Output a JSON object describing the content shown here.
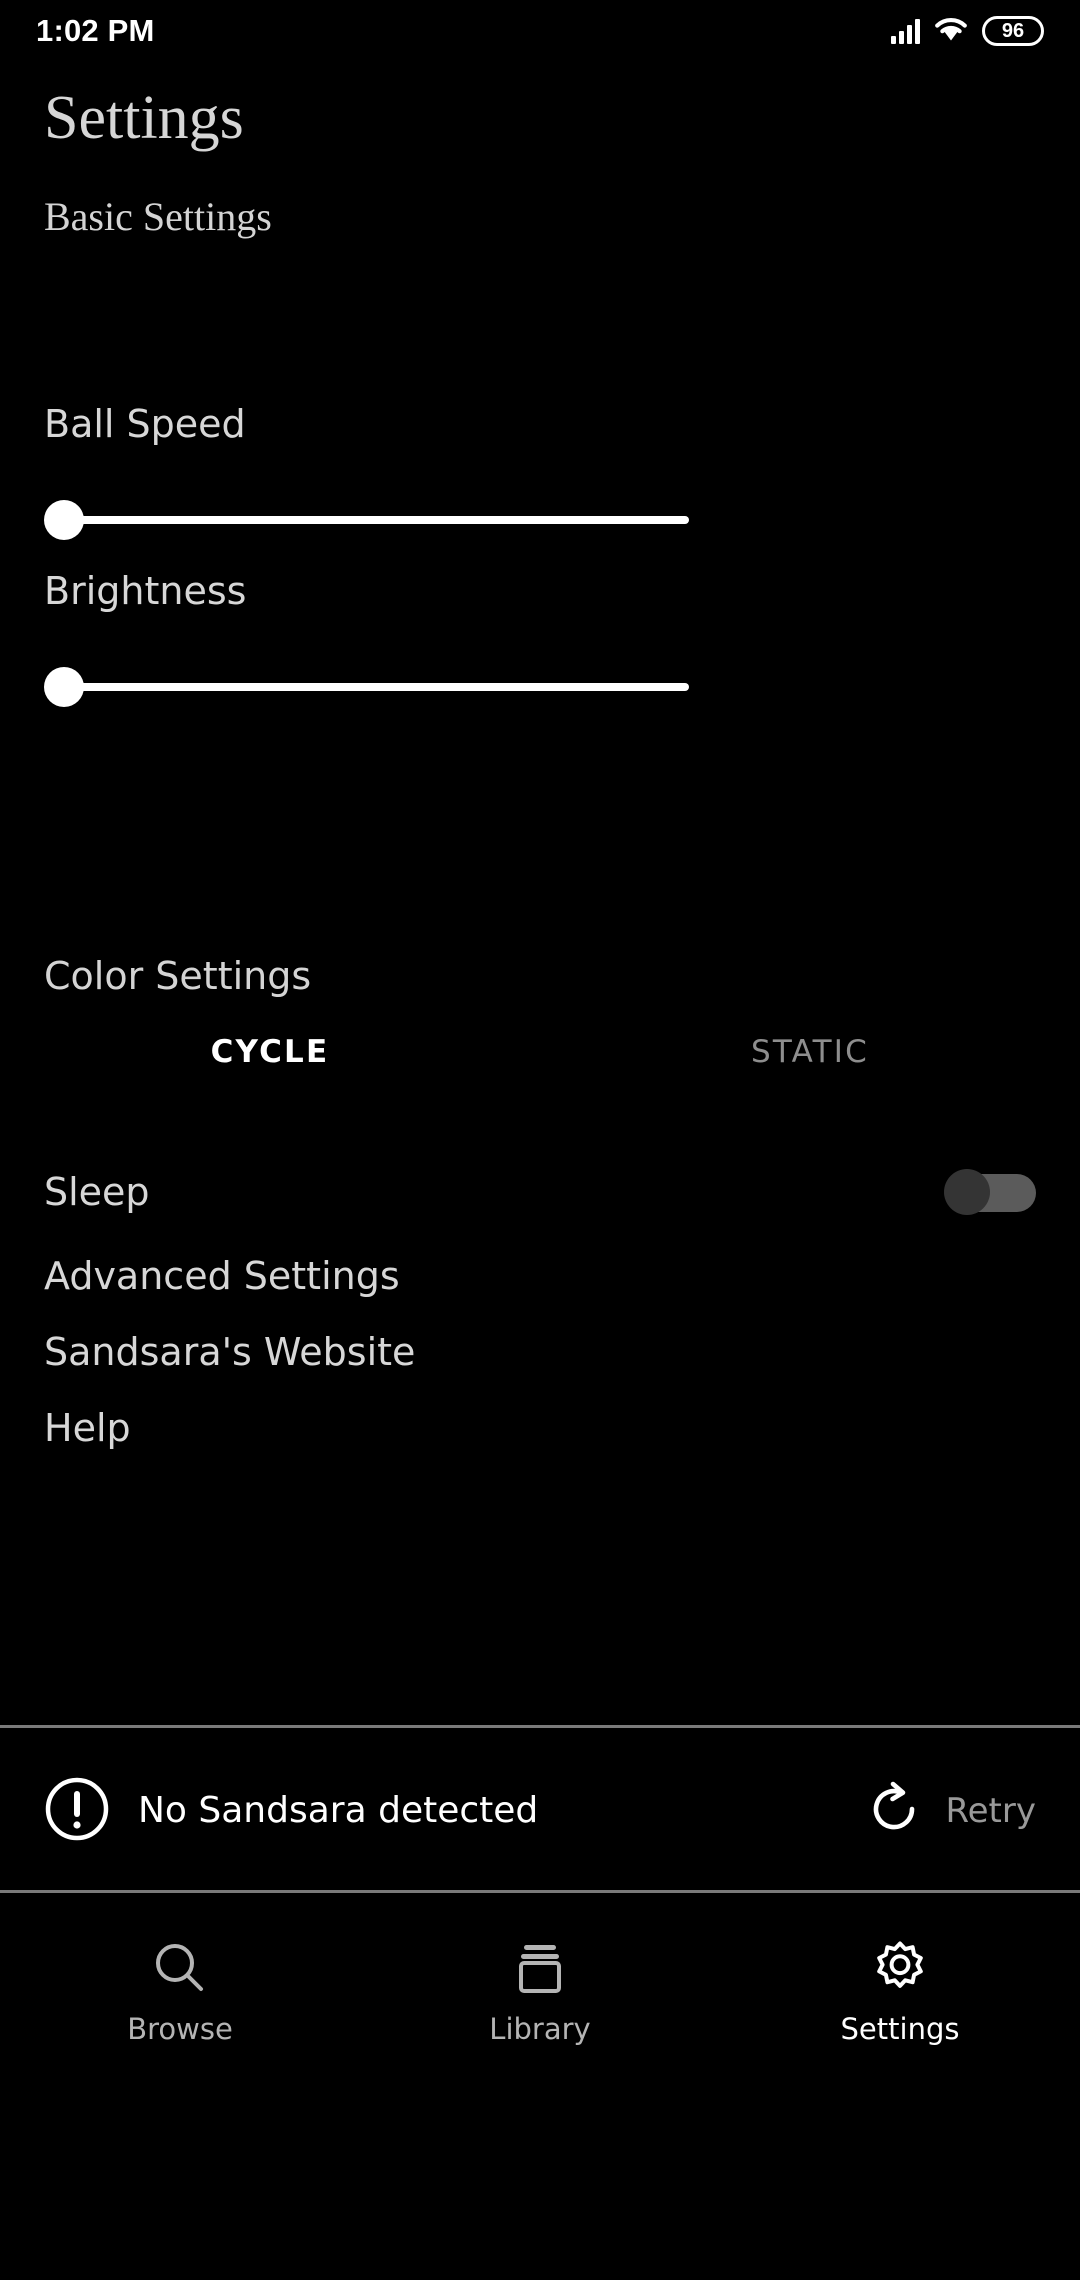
{
  "status_bar": {
    "clock": "1:02 PM",
    "signal_icon": "cellular-signal-icon",
    "wifi_icon": "wifi-icon",
    "battery_level": "96"
  },
  "header": {
    "title": "Settings"
  },
  "basic_settings": {
    "section_title": "Basic Settings",
    "sliders": [
      {
        "label": "Ball Speed",
        "value_percent": 0
      },
      {
        "label": "Brightness",
        "value_percent": 0
      }
    ]
  },
  "color_settings": {
    "section_title": "Color Settings",
    "tabs": [
      {
        "label": "CYCLE",
        "active": true
      },
      {
        "label": "STATIC",
        "active": false
      }
    ]
  },
  "sleep": {
    "label": "Sleep",
    "enabled": false
  },
  "menu": {
    "items": [
      {
        "label": "Advanced Settings"
      },
      {
        "label": "Sandsara's Website"
      },
      {
        "label": "Help"
      }
    ]
  },
  "connection_banner": {
    "alert_icon": "alert-circle-icon",
    "status_text": "No Sandsara detected",
    "retry_icon": "refresh-icon",
    "retry_label": "Retry"
  },
  "bottom_nav": {
    "items": [
      {
        "label": "Browse",
        "icon": "search-icon",
        "active": false
      },
      {
        "label": "Library",
        "icon": "library-icon",
        "active": false
      },
      {
        "label": "Settings",
        "icon": "gear-icon",
        "active": true
      }
    ]
  },
  "colors": {
    "background": "#000000",
    "primary_text": "#d7d7d7",
    "active_text": "#ffffff",
    "inactive_text": "#8e8e8e",
    "divider": "#7a7a7a",
    "slider_track": "#ffffff",
    "toggle_track_off": "#5b5b5b",
    "toggle_thumb_off": "#343434"
  }
}
